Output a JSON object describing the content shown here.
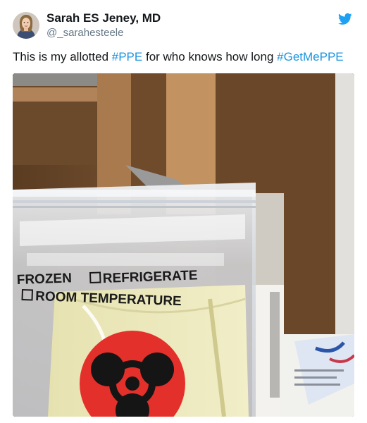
{
  "user": {
    "display_name": "Sarah ES Jeney, MD",
    "handle": "@_sarahesteele",
    "avatar_icon": "profile-photo"
  },
  "tweet": {
    "text_before": "This is my allotted ",
    "hashtag_1": "#PPE",
    "text_middle": " for who knows how long ",
    "hashtag_2": "#GetMePPE"
  },
  "brand": {
    "icon": "twitter-bird-icon",
    "color": "#1da1f2",
    "hashtag_color": "#1b95e0"
  },
  "photo": {
    "bag_label_1": "FROZEN",
    "bag_label_2": "REFRIGERATE",
    "bag_label_3": "ROOM TEMPERATURE"
  }
}
